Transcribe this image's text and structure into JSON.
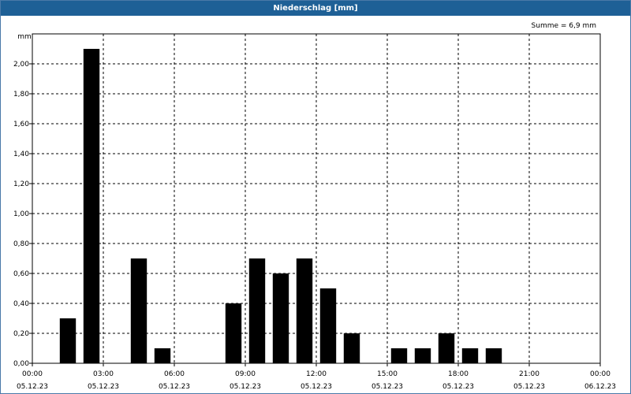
{
  "window": {
    "title": "Niederschlag [mm]"
  },
  "chart_data": {
    "type": "bar",
    "title": "Niederschlag [mm]",
    "ylabel": "mm",
    "xlabel": "",
    "summary": "Summe = 6,9 mm",
    "ylim": [
      0,
      2.2
    ],
    "yticks": [
      "0,00",
      "0,20",
      "0,40",
      "0,60",
      "0,80",
      "1,00",
      "1,20",
      "1,40",
      "1,60",
      "1,80",
      "2,00"
    ],
    "xlim": [
      "2023-12-05 00:00",
      "2023-12-06 00:00"
    ],
    "xticks": [
      {
        "time": "00:00",
        "date": "05.12.23"
      },
      {
        "time": "03:00",
        "date": "05.12.23"
      },
      {
        "time": "06:00",
        "date": "05.12.23"
      },
      {
        "time": "09:00",
        "date": "05.12.23"
      },
      {
        "time": "12:00",
        "date": "05.12.23"
      },
      {
        "time": "15:00",
        "date": "05.12.23"
      },
      {
        "time": "18:00",
        "date": "05.12.23"
      },
      {
        "time": "21:00",
        "date": "05.12.23"
      },
      {
        "time": "00:00",
        "date": "06.12.23"
      }
    ],
    "grid": true,
    "bar_color": "#000000",
    "points": [
      {
        "hour": 1.5,
        "value": 0.3
      },
      {
        "hour": 2.5,
        "value": 2.1
      },
      {
        "hour": 4.5,
        "value": 0.7
      },
      {
        "hour": 5.5,
        "value": 0.1
      },
      {
        "hour": 8.5,
        "value": 0.4
      },
      {
        "hour": 9.5,
        "value": 0.7
      },
      {
        "hour": 10.5,
        "value": 0.6
      },
      {
        "hour": 11.5,
        "value": 0.7
      },
      {
        "hour": 12.5,
        "value": 0.5
      },
      {
        "hour": 13.5,
        "value": 0.2
      },
      {
        "hour": 15.5,
        "value": 0.1
      },
      {
        "hour": 16.5,
        "value": 0.1
      },
      {
        "hour": 17.5,
        "value": 0.2
      },
      {
        "hour": 18.5,
        "value": 0.1
      },
      {
        "hour": 19.5,
        "value": 0.1
      }
    ]
  }
}
